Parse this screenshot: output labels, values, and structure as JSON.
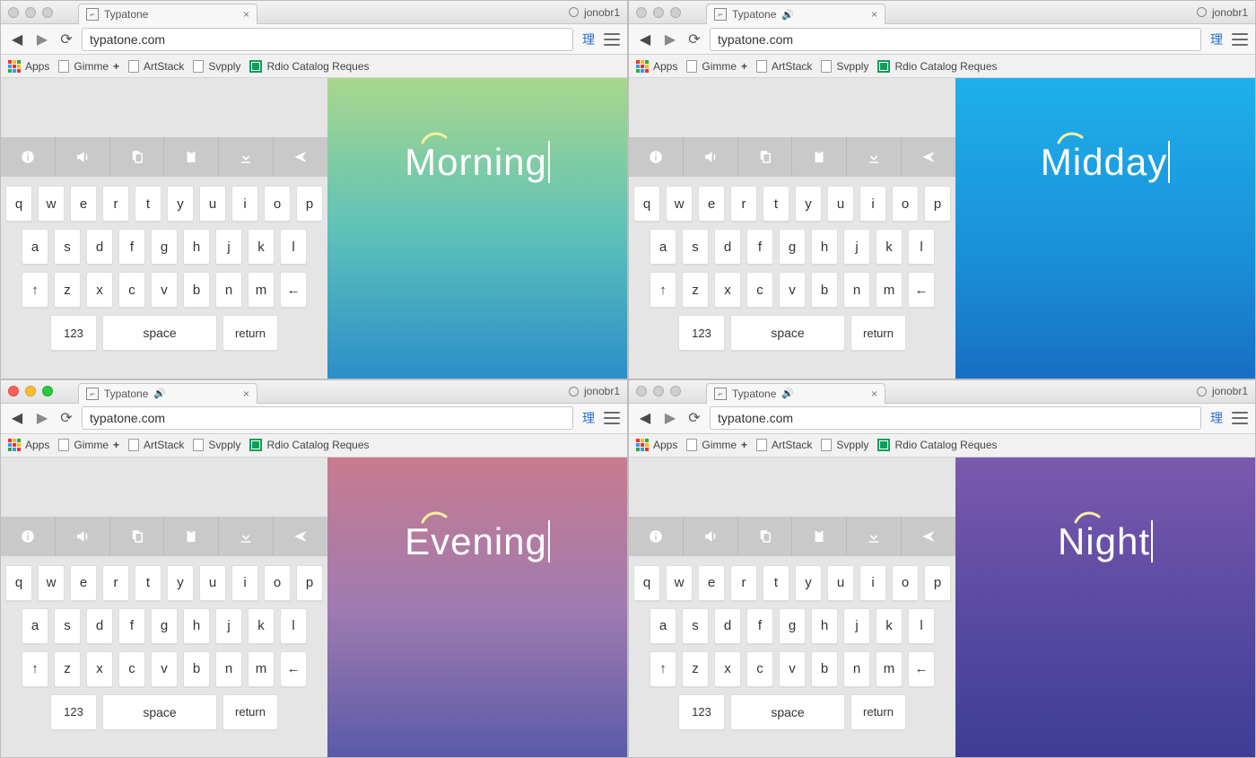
{
  "tab_title": "Typatone",
  "url": "typatone.com",
  "profile": "jonobr1",
  "ime_glyph": "理",
  "bookmarks": {
    "apps": "Apps",
    "gimme": "Gimme",
    "artstack": "ArtStack",
    "svpply": "Svpply",
    "rdio": "Rdio Catalog Reques"
  },
  "keyboard": {
    "row1": [
      "q",
      "w",
      "e",
      "r",
      "t",
      "y",
      "u",
      "i",
      "o",
      "p"
    ],
    "row2": [
      "a",
      "s",
      "d",
      "f",
      "g",
      "h",
      "j",
      "k",
      "l"
    ],
    "row3": [
      "↑",
      "z",
      "x",
      "c",
      "v",
      "b",
      "n",
      "m",
      "←"
    ],
    "num": "123",
    "space": "space",
    "return": "return"
  },
  "panes": [
    {
      "label": "Morning",
      "gradient": "g-morning",
      "show_audio": false,
      "dots_colored": false
    },
    {
      "label": "Midday",
      "gradient": "g-midday",
      "show_audio": true,
      "dots_colored": false
    },
    {
      "label": "Evening",
      "gradient": "g-evening",
      "show_audio": true,
      "dots_colored": true
    },
    {
      "label": "Night",
      "gradient": "g-night",
      "show_audio": true,
      "dots_colored": false
    }
  ]
}
